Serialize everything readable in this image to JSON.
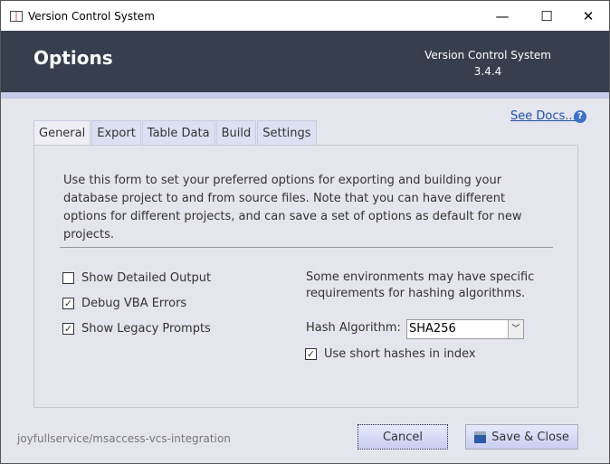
{
  "window": {
    "title": "Version Control System",
    "minimize": "—",
    "maximize": "☐",
    "close": "✕"
  },
  "header": {
    "title": "Options",
    "app_name": "Version Control System",
    "version": "3.4.4"
  },
  "docs_link": "See Docs...",
  "tabs": [
    {
      "label": "General"
    },
    {
      "label": "Export"
    },
    {
      "label": "Table Data"
    },
    {
      "label": "Build"
    },
    {
      "label": "Settings"
    }
  ],
  "general": {
    "intro": "Use this form to set your preferred options for exporting and building your database project to and from source files. Note that you can have different options for different projects, and can save a set of options as default for new projects.",
    "options": [
      {
        "label": "Show Detailed Output",
        "checked": false
      },
      {
        "label": "Debug VBA Errors",
        "checked": true
      },
      {
        "label": "Show Legacy Prompts",
        "checked": true
      }
    ],
    "hash_note": "Some environments may have specific requirements for hashing algorithms.",
    "hash_label": "Hash Algorithm:",
    "hash_value": "SHA256",
    "short_hashes": {
      "label": "Use short hashes in index",
      "checked": true
    }
  },
  "footer": {
    "repo": "joyfullservice/msaccess-vcs-integration",
    "cancel": "Cancel",
    "save": "Save & Close"
  }
}
